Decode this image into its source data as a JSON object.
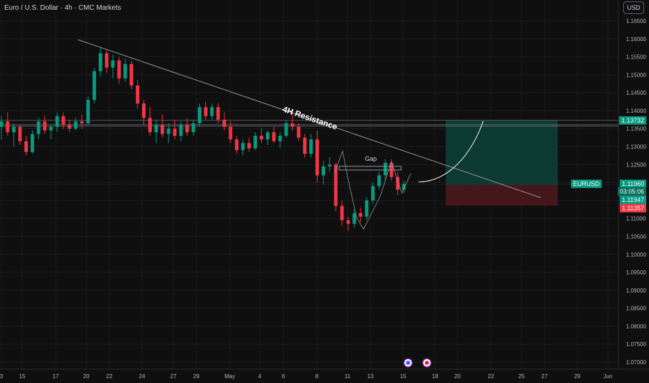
{
  "header": {
    "title": "Euro / U.S. Dollar · 4h · CMC Markets",
    "currency": "USD"
  },
  "annotations": {
    "resistance": "4H Resistance",
    "gap": "Gap"
  },
  "price_tags": {
    "target": "1.13732",
    "symbol": "EURUSD",
    "current": "1.11960",
    "countdown": "03:05:06",
    "entry": "1.11947",
    "stop": "1.11357"
  },
  "colors": {
    "up": "#089981",
    "down": "#f23645",
    "target_zone": "#0c3f36",
    "stop_zone": "#4a1a1c",
    "background": "#0f0f0f"
  },
  "icons": [
    "eu-flag-icon",
    "us-flag-icon"
  ],
  "chart_data": {
    "type": "candlestick",
    "symbol": "EURUSD",
    "timeframe": "4h",
    "y_ticks": [
      "1.16500",
      "1.16000",
      "1.15500",
      "1.15000",
      "1.14500",
      "1.14000",
      "1.13500",
      "1.13000",
      "1.12500",
      "1.12000",
      "1.11500",
      "1.11000",
      "1.10500",
      "1.10000",
      "1.09500",
      "1.09000",
      "1.08500",
      "1.08000",
      "1.07500",
      "1.07000"
    ],
    "ylim": [
      1.0685,
      1.1685
    ],
    "x_ticks": [
      "3",
      "15",
      "17",
      "20",
      "22",
      "24",
      "27",
      "29",
      "May",
      "4",
      "6",
      "8",
      "11",
      "13",
      "15",
      "18",
      "20",
      "22",
      "25",
      "27",
      "29",
      "Jun"
    ],
    "candles": [
      {
        "o": 1.1355,
        "h": 1.1385,
        "l": 1.132,
        "c": 1.137
      },
      {
        "o": 1.137,
        "h": 1.1395,
        "l": 1.133,
        "c": 1.134
      },
      {
        "o": 1.134,
        "h": 1.1365,
        "l": 1.13,
        "c": 1.1355
      },
      {
        "o": 1.1355,
        "h": 1.136,
        "l": 1.1305,
        "c": 1.1315
      },
      {
        "o": 1.1315,
        "h": 1.133,
        "l": 1.1275,
        "c": 1.1285
      },
      {
        "o": 1.1285,
        "h": 1.1345,
        "l": 1.128,
        "c": 1.1335
      },
      {
        "o": 1.1335,
        "h": 1.138,
        "l": 1.132,
        "c": 1.137
      },
      {
        "o": 1.137,
        "h": 1.1385,
        "l": 1.1335,
        "c": 1.1345
      },
      {
        "o": 1.1345,
        "h": 1.136,
        "l": 1.132,
        "c": 1.1355
      },
      {
        "o": 1.1355,
        "h": 1.1395,
        "l": 1.134,
        "c": 1.1385
      },
      {
        "o": 1.1385,
        "h": 1.1395,
        "l": 1.135,
        "c": 1.136
      },
      {
        "o": 1.136,
        "h": 1.1375,
        "l": 1.134,
        "c": 1.135
      },
      {
        "o": 1.135,
        "h": 1.138,
        "l": 1.1345,
        "c": 1.137
      },
      {
        "o": 1.137,
        "h": 1.139,
        "l": 1.135,
        "c": 1.1365
      },
      {
        "o": 1.1365,
        "h": 1.144,
        "l": 1.136,
        "c": 1.143
      },
      {
        "o": 1.143,
        "h": 1.152,
        "l": 1.142,
        "c": 1.151
      },
      {
        "o": 1.151,
        "h": 1.1575,
        "l": 1.1495,
        "c": 1.156
      },
      {
        "o": 1.156,
        "h": 1.157,
        "l": 1.1505,
        "c": 1.152
      },
      {
        "o": 1.152,
        "h": 1.1555,
        "l": 1.149,
        "c": 1.154
      },
      {
        "o": 1.154,
        "h": 1.155,
        "l": 1.1475,
        "c": 1.149
      },
      {
        "o": 1.149,
        "h": 1.1545,
        "l": 1.148,
        "c": 1.153
      },
      {
        "o": 1.153,
        "h": 1.154,
        "l": 1.146,
        "c": 1.147
      },
      {
        "o": 1.147,
        "h": 1.1485,
        "l": 1.1405,
        "c": 1.142
      },
      {
        "o": 1.142,
        "h": 1.143,
        "l": 1.136,
        "c": 1.138
      },
      {
        "o": 1.138,
        "h": 1.141,
        "l": 1.133,
        "c": 1.134
      },
      {
        "o": 1.134,
        "h": 1.1375,
        "l": 1.131,
        "c": 1.136
      },
      {
        "o": 1.136,
        "h": 1.139,
        "l": 1.1325,
        "c": 1.1335
      },
      {
        "o": 1.1335,
        "h": 1.1365,
        "l": 1.131,
        "c": 1.135
      },
      {
        "o": 1.135,
        "h": 1.1375,
        "l": 1.132,
        "c": 1.133
      },
      {
        "o": 1.133,
        "h": 1.137,
        "l": 1.1315,
        "c": 1.136
      },
      {
        "o": 1.136,
        "h": 1.138,
        "l": 1.133,
        "c": 1.134
      },
      {
        "o": 1.134,
        "h": 1.1375,
        "l": 1.133,
        "c": 1.1365
      },
      {
        "o": 1.1365,
        "h": 1.142,
        "l": 1.1355,
        "c": 1.141
      },
      {
        "o": 1.141,
        "h": 1.1425,
        "l": 1.1375,
        "c": 1.1385
      },
      {
        "o": 1.1385,
        "h": 1.142,
        "l": 1.1375,
        "c": 1.141
      },
      {
        "o": 1.141,
        "h": 1.142,
        "l": 1.1365,
        "c": 1.1375
      },
      {
        "o": 1.1375,
        "h": 1.1395,
        "l": 1.1345,
        "c": 1.1355
      },
      {
        "o": 1.1355,
        "h": 1.137,
        "l": 1.131,
        "c": 1.132
      },
      {
        "o": 1.132,
        "h": 1.133,
        "l": 1.128,
        "c": 1.129
      },
      {
        "o": 1.129,
        "h": 1.132,
        "l": 1.1275,
        "c": 1.131
      },
      {
        "o": 1.131,
        "h": 1.1325,
        "l": 1.1285,
        "c": 1.1295
      },
      {
        "o": 1.1295,
        "h": 1.134,
        "l": 1.129,
        "c": 1.133
      },
      {
        "o": 1.133,
        "h": 1.135,
        "l": 1.131,
        "c": 1.132
      },
      {
        "o": 1.132,
        "h": 1.1345,
        "l": 1.1305,
        "c": 1.134
      },
      {
        "o": 1.134,
        "h": 1.1355,
        "l": 1.131,
        "c": 1.1315
      },
      {
        "o": 1.1315,
        "h": 1.134,
        "l": 1.1295,
        "c": 1.133
      },
      {
        "o": 1.133,
        "h": 1.1375,
        "l": 1.1325,
        "c": 1.1365
      },
      {
        "o": 1.1365,
        "h": 1.1395,
        "l": 1.1345,
        "c": 1.1355
      },
      {
        "o": 1.1355,
        "h": 1.1365,
        "l": 1.1315,
        "c": 1.1325
      },
      {
        "o": 1.1325,
        "h": 1.1335,
        "l": 1.127,
        "c": 1.128
      },
      {
        "o": 1.128,
        "h": 1.1335,
        "l": 1.127,
        "c": 1.132
      },
      {
        "o": 1.132,
        "h": 1.1345,
        "l": 1.12,
        "c": 1.122
      },
      {
        "o": 1.122,
        "h": 1.126,
        "l": 1.1195,
        "c": 1.1245
      },
      {
        "o": 1.1245,
        "h": 1.127,
        "l": 1.123,
        "c": 1.125
      },
      {
        "o": 1.125,
        "h": 1.1255,
        "l": 1.112,
        "c": 1.1135
      },
      {
        "o": 1.1135,
        "h": 1.115,
        "l": 1.108,
        "c": 1.1095
      },
      {
        "o": 1.1095,
        "h": 1.1105,
        "l": 1.1065,
        "c": 1.1085
      },
      {
        "o": 1.1085,
        "h": 1.1125,
        "l": 1.1075,
        "c": 1.1115
      },
      {
        "o": 1.1115,
        "h": 1.113,
        "l": 1.109,
        "c": 1.1105
      },
      {
        "o": 1.1105,
        "h": 1.116,
        "l": 1.1095,
        "c": 1.115
      },
      {
        "o": 1.115,
        "h": 1.12,
        "l": 1.114,
        "c": 1.119
      },
      {
        "o": 1.119,
        "h": 1.123,
        "l": 1.118,
        "c": 1.122
      },
      {
        "o": 1.122,
        "h": 1.1265,
        "l": 1.1205,
        "c": 1.1255
      },
      {
        "o": 1.1255,
        "h": 1.1265,
        "l": 1.1205,
        "c": 1.1215
      },
      {
        "o": 1.1215,
        "h": 1.123,
        "l": 1.1165,
        "c": 1.118
      },
      {
        "o": 1.118,
        "h": 1.1205,
        "l": 1.117,
        "c": 1.1196
      }
    ],
    "trendlines": [
      {
        "name": "4H Resistance",
        "from": {
          "date": "Apr 14",
          "price": 1.1595
        },
        "to": {
          "date": "May 28",
          "price": 1.1137
        }
      }
    ],
    "horizontal_levels": [
      1.1373,
      1.1361,
      1.1357
    ],
    "gap_zone": {
      "from": 1.1245,
      "to": 1.1235
    },
    "position": {
      "entry": 1.11947,
      "target": 1.13732,
      "stop": 1.11357
    }
  }
}
